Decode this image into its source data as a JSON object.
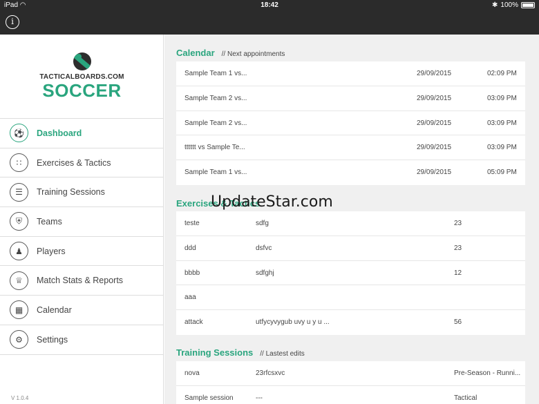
{
  "status_bar": {
    "device": "iPad",
    "time": "18:42",
    "battery": "100%"
  },
  "logo": {
    "brand": "TACTICALBOARDS.COM",
    "product": "SOCCER"
  },
  "nav": [
    {
      "label": "Dashboard",
      "icon": "soccer-ball-icon",
      "active": true
    },
    {
      "label": "Exercises & Tactics",
      "icon": "tactics-icon"
    },
    {
      "label": "Training Sessions",
      "icon": "list-icon"
    },
    {
      "label": "Teams",
      "icon": "shield-icon"
    },
    {
      "label": "Players",
      "icon": "players-icon"
    },
    {
      "label": "Match Stats & Reports",
      "icon": "trophy-icon"
    },
    {
      "label": "Calendar",
      "icon": "calendar-icon"
    },
    {
      "label": "Settings",
      "icon": "gear-icon"
    }
  ],
  "version": "V 1.0.4",
  "calendar": {
    "title": "Calendar",
    "subtitle": "// Next appointments",
    "rows": [
      {
        "name": "Sample Team 1 vs...",
        "date": "29/09/2015",
        "time": "02:09 PM"
      },
      {
        "name": "Sample Team 2 vs...",
        "date": "29/09/2015",
        "time": "03:09 PM"
      },
      {
        "name": "Sample Team 2 vs...",
        "date": "29/09/2015",
        "time": "03:09 PM"
      },
      {
        "name": "tttttt vs Sample Te...",
        "date": "29/09/2015",
        "time": "03:09 PM"
      },
      {
        "name": "Sample Team 1 vs...",
        "date": "29/09/2015",
        "time": "05:09 PM"
      }
    ]
  },
  "exercises": {
    "title": "Exercises & Tactics",
    "rows": [
      {
        "name": "teste",
        "desc": "sdfg",
        "count": "23"
      },
      {
        "name": "ddd",
        "desc": "dsfvc",
        "count": "23"
      },
      {
        "name": "bbbb",
        "desc": "sdfghj",
        "count": "12"
      },
      {
        "name": "aaa",
        "desc": "",
        "count": ""
      },
      {
        "name": "attack",
        "desc": "utfycyvygub uvy  u y u ...",
        "count": "56"
      }
    ]
  },
  "training": {
    "title": "Training Sessions",
    "subtitle": "// Lastest edits",
    "rows": [
      {
        "name": "nova",
        "desc": "23rfcsxvc",
        "category": "Pre-Season - Runni..."
      },
      {
        "name": "Sample session",
        "desc": "---",
        "category": "Tactical"
      }
    ]
  },
  "watermark": "UpdateStar.com"
}
